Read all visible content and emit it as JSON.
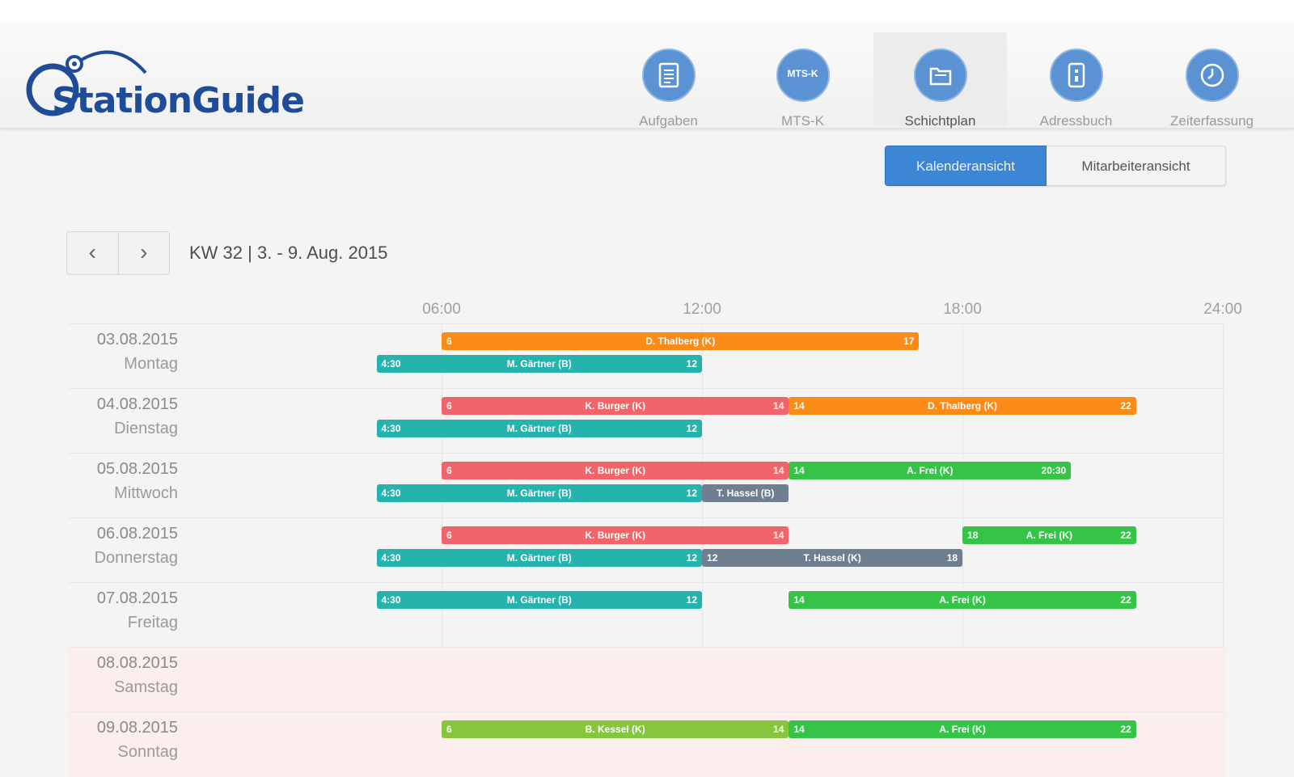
{
  "app": {
    "logo_text": "StationGuide"
  },
  "nav": [
    {
      "label": "Aufgaben",
      "icon": "clipboard-icon",
      "active": false
    },
    {
      "label": "MTS-K",
      "icon": "mtsk-icon",
      "icon_text": "MTS-K",
      "active": false
    },
    {
      "label": "Schichtplan",
      "icon": "calendar-icon",
      "active": true
    },
    {
      "label": "Adressbuch",
      "icon": "addressbook-icon",
      "active": false
    },
    {
      "label": "Zeiterfassung",
      "icon": "clock-icon",
      "active": false
    }
  ],
  "view_toggle": {
    "calendar_label": "Kalenderansicht",
    "employee_label": "Mitarbeiteransicht",
    "selected": "calendar"
  },
  "pager": {
    "prev": "‹",
    "next": "›"
  },
  "week_label": "KW 32 | 3. - 9. Aug. 2015",
  "axis": [
    "06:00",
    "12:00",
    "18:00",
    "24:00"
  ],
  "colors": {
    "orange": "#fb8b17",
    "red": "#f0646a",
    "teal": "#27b3ad",
    "green": "#35c448",
    "gray": "#6f7f8f",
    "lime": "#86c63c",
    "accent": "#3d86d6",
    "weekend_bg": "#fdeeee"
  },
  "days": [
    {
      "date": "03.08.2015",
      "name": "Montag",
      "weekend": false,
      "shifts": [
        {
          "lane": 0,
          "start": 6,
          "end": 17,
          "start_label": "6",
          "end_label": "17",
          "name": "D. Thalberg (K)",
          "color": "orange"
        },
        {
          "lane": 1,
          "start": 4.5,
          "end": 12,
          "start_label": "4:30",
          "end_label": "12",
          "name": "M. Gärtner (B)",
          "color": "teal"
        }
      ]
    },
    {
      "date": "04.08.2015",
      "name": "Dienstag",
      "weekend": false,
      "shifts": [
        {
          "lane": 0,
          "start": 6,
          "end": 14,
          "start_label": "6",
          "end_label": "14",
          "name": "K. Burger (K)",
          "color": "red"
        },
        {
          "lane": 0,
          "start": 14,
          "end": 22,
          "start_label": "14",
          "end_label": "22",
          "name": "D. Thalberg (K)",
          "color": "orange"
        },
        {
          "lane": 1,
          "start": 4.5,
          "end": 12,
          "start_label": "4:30",
          "end_label": "12",
          "name": "M. Gärtner (B)",
          "color": "teal"
        }
      ]
    },
    {
      "date": "05.08.2015",
      "name": "Mittwoch",
      "weekend": false,
      "shifts": [
        {
          "lane": 0,
          "start": 6,
          "end": 14,
          "start_label": "6",
          "end_label": "14",
          "name": "K. Burger (K)",
          "color": "red"
        },
        {
          "lane": 0,
          "start": 14,
          "end": 20.5,
          "start_label": "14",
          "end_label": "20:30",
          "name": "A. Frei (K)",
          "color": "green"
        },
        {
          "lane": 1,
          "start": 4.5,
          "end": 12,
          "start_label": "4:30",
          "end_label": "12",
          "name": "M. Gärtner (B)",
          "color": "teal"
        },
        {
          "lane": 1,
          "start": 12,
          "end": 14,
          "start_label": "",
          "end_label": "",
          "name": "T. Hassel (B)",
          "color": "gray"
        }
      ]
    },
    {
      "date": "06.08.2015",
      "name": "Donnerstag",
      "weekend": false,
      "shifts": [
        {
          "lane": 0,
          "start": 6,
          "end": 14,
          "start_label": "6",
          "end_label": "14",
          "name": "K. Burger (K)",
          "color": "red"
        },
        {
          "lane": 0,
          "start": 18,
          "end": 22,
          "start_label": "18",
          "end_label": "22",
          "name": "A. Frei (K)",
          "color": "green"
        },
        {
          "lane": 1,
          "start": 4.5,
          "end": 12,
          "start_label": "4:30",
          "end_label": "12",
          "name": "M. Gärtner (B)",
          "color": "teal"
        },
        {
          "lane": 1,
          "start": 12,
          "end": 18,
          "start_label": "12",
          "end_label": "18",
          "name": "T. Hassel (K)",
          "color": "gray"
        }
      ]
    },
    {
      "date": "07.08.2015",
      "name": "Freitag",
      "weekend": false,
      "shifts": [
        {
          "lane": 0,
          "start": 4.5,
          "end": 12,
          "start_label": "4:30",
          "end_label": "12",
          "name": "M. Gärtner (B)",
          "color": "teal"
        },
        {
          "lane": 0,
          "start": 14,
          "end": 22,
          "start_label": "14",
          "end_label": "22",
          "name": "A. Frei (K)",
          "color": "green"
        }
      ]
    },
    {
      "date": "08.08.2015",
      "name": "Samstag",
      "weekend": true,
      "shifts": []
    },
    {
      "date": "09.08.2015",
      "name": "Sonntag",
      "weekend": true,
      "shifts": [
        {
          "lane": 0,
          "start": 6,
          "end": 14,
          "start_label": "6",
          "end_label": "14",
          "name": "B. Kessel (K)",
          "color": "lime"
        },
        {
          "lane": 0,
          "start": 14,
          "end": 22,
          "start_label": "14",
          "end_label": "22",
          "name": "A. Frei (K)",
          "color": "green"
        }
      ]
    }
  ]
}
